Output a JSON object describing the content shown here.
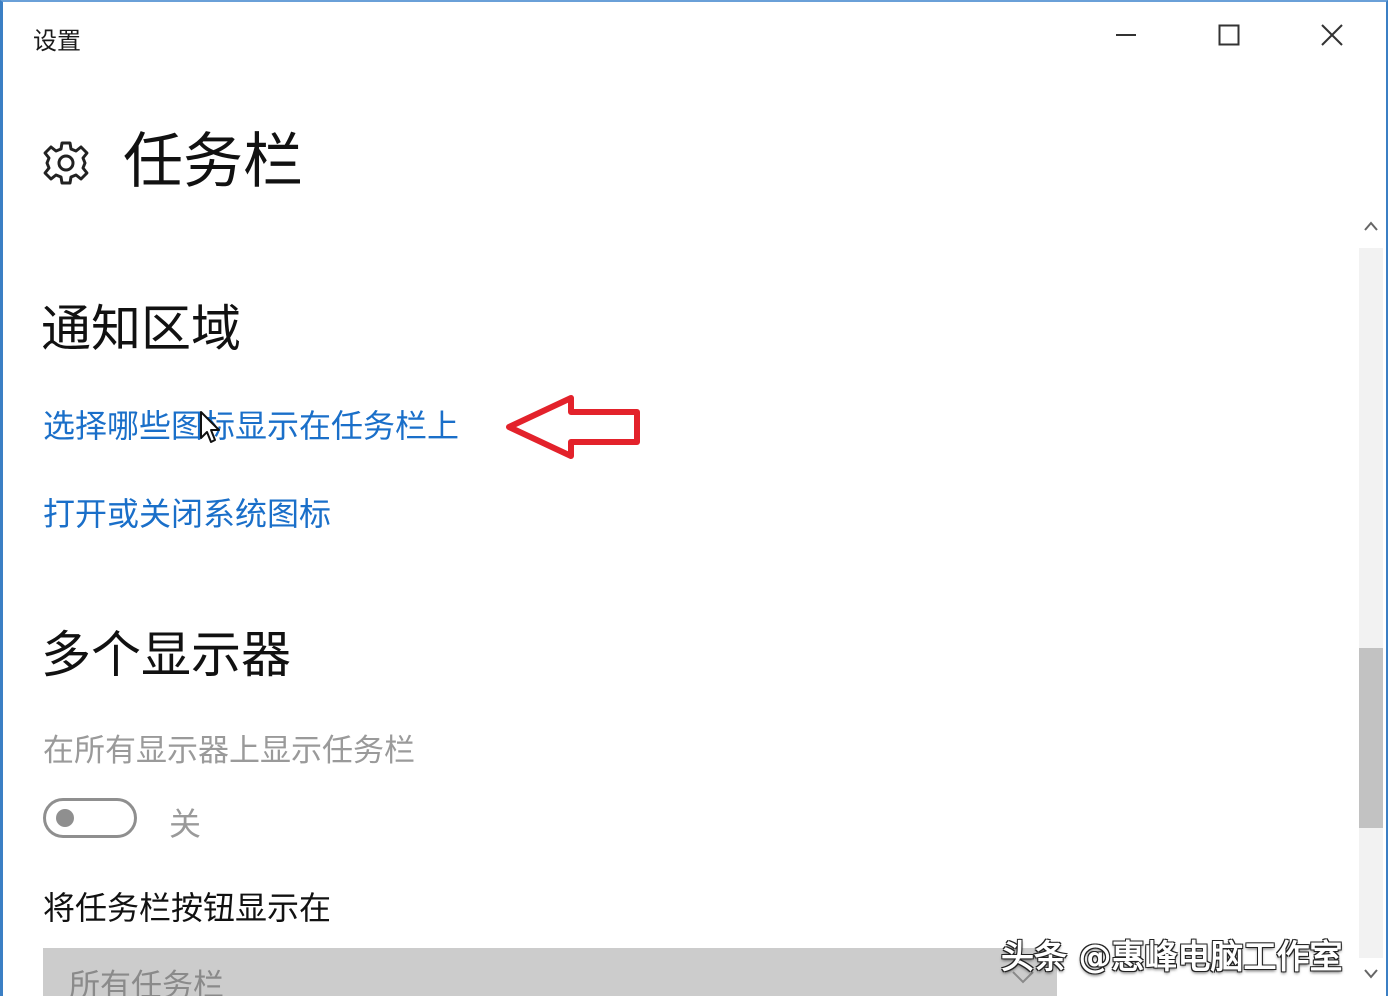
{
  "window": {
    "title": "设置",
    "controls": {
      "minimize": "minimize-icon",
      "maximize": "maximize-icon",
      "close": "close-icon"
    }
  },
  "header": {
    "icon": "gear-icon",
    "title": "任务栏"
  },
  "notification_area": {
    "heading": "通知区域",
    "links": [
      "选择哪些图标显示在任务栏上",
      "打开或关闭系统图标"
    ]
  },
  "multiple_displays": {
    "heading": "多个显示器",
    "show_taskbar_label": "在所有显示器上显示任务栏",
    "toggle": {
      "state_label": "关",
      "on": false
    },
    "buttons_label": "将任务栏按钮显示在",
    "dropdown_value": "所有任务栏"
  },
  "annotation": {
    "type": "red-arrow",
    "color": "#e3222b"
  },
  "watermark": "头条 @惠峰电脑工作室",
  "colors": {
    "link": "#1a6fc9",
    "window_border": "#3b7fc4",
    "disabled_text": "#9a9a9a"
  }
}
